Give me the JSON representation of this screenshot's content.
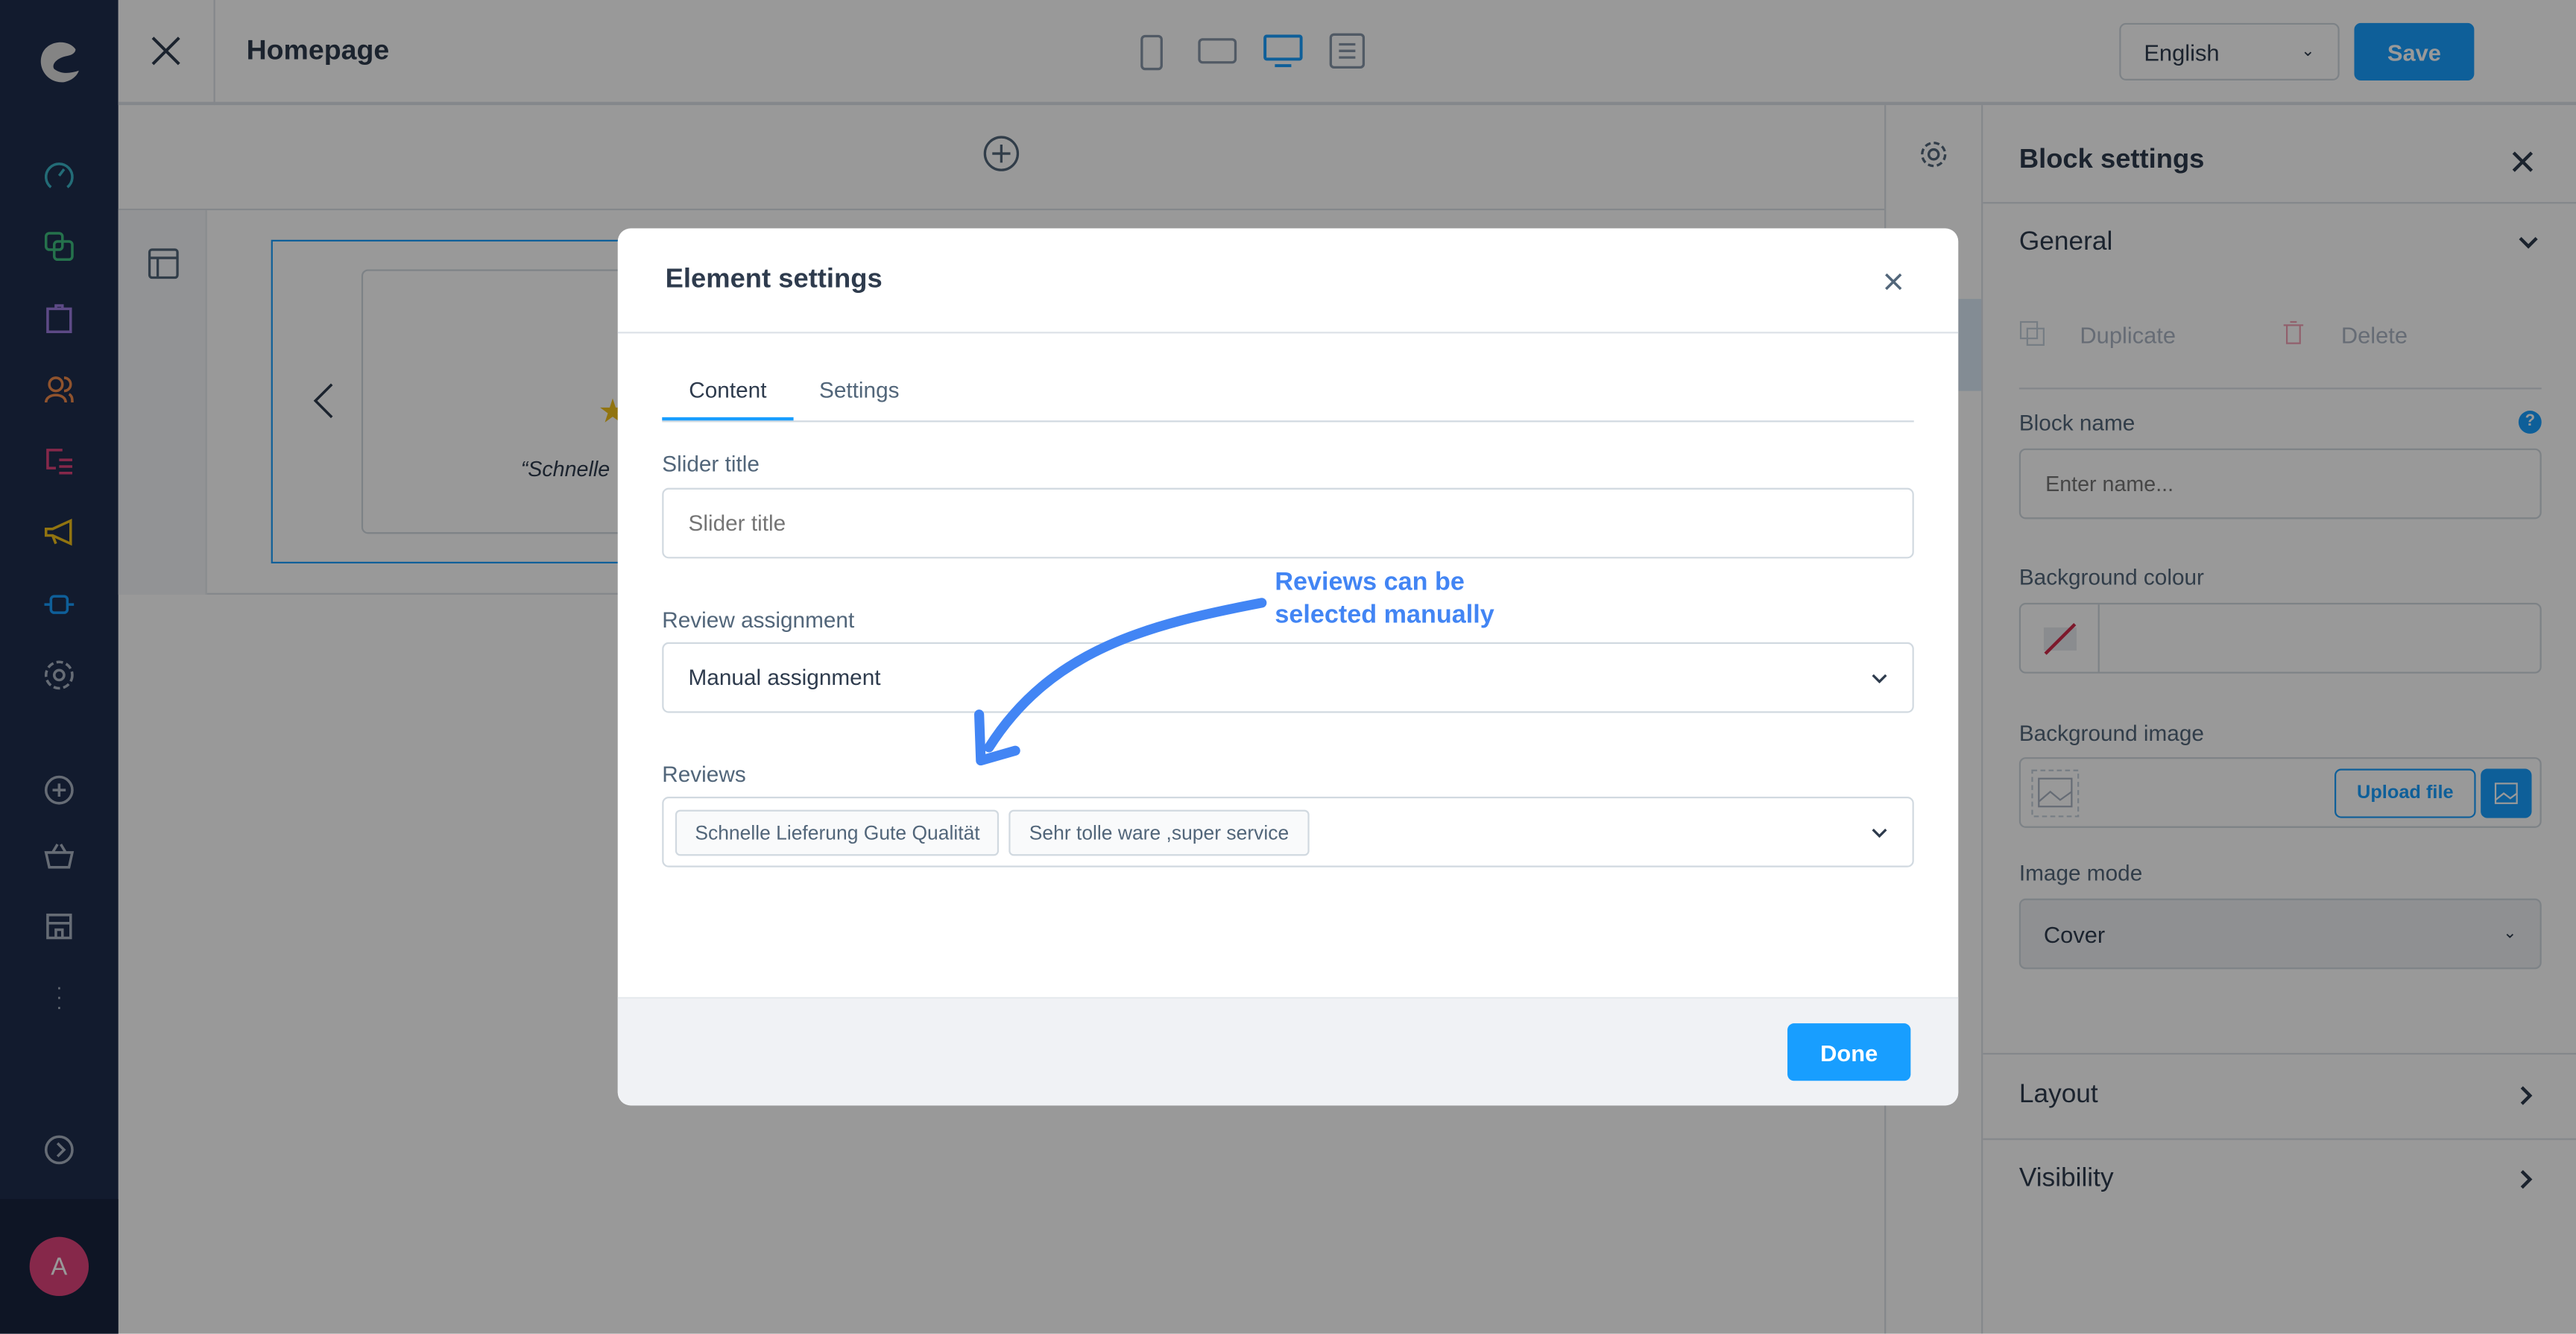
{
  "header": {
    "title": "Homepage",
    "language": "English",
    "save_label": "Save"
  },
  "canvas": {
    "review_preview": "“Schnelle"
  },
  "block_settings": {
    "title": "Block settings",
    "general": "General",
    "duplicate": "Duplicate",
    "delete": "Delete",
    "block_name_label": "Block name",
    "block_name_placeholder": "Enter name...",
    "bg_colour_label": "Background colour",
    "bg_image_label": "Background image",
    "upload_label": "Upload file",
    "image_mode_label": "Image mode",
    "image_mode_value": "Cover",
    "layout": "Layout",
    "visibility": "Visibility"
  },
  "sidebar": {
    "avatar_initial": "A"
  },
  "modal": {
    "title": "Element settings",
    "tabs": [
      {
        "label": "Content",
        "active": true
      },
      {
        "label": "Settings",
        "active": false
      }
    ],
    "slider_title_label": "Slider title",
    "slider_title_placeholder": "Slider title",
    "review_assignment_label": "Review assignment",
    "review_assignment_value": "Manual assignment",
    "reviews_label": "Reviews",
    "reviews_selected": [
      "Schnelle Lieferung Gute Qualität",
      "Sehr tolle ware ,super service"
    ],
    "done_label": "Done"
  },
  "annotation": {
    "line1": "Reviews can be",
    "line2": "selected manually",
    "color": "#4285f4"
  },
  "colors": {
    "accent": "#189eff",
    "sidebar": "#1f2d4d"
  }
}
